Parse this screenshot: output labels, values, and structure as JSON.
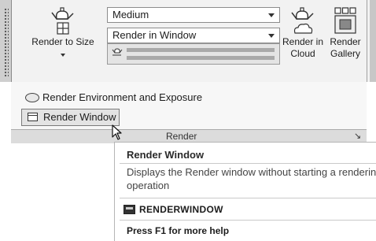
{
  "ribbon": {
    "render_to_size_label": "Render to Size",
    "quality_dropdown": "Medium",
    "output_dropdown": "Render in Window",
    "render_in_cloud_label_1": "Render in",
    "render_in_cloud_label_2": "Cloud",
    "render_gallery_label_1": "Render",
    "render_gallery_label_2": "Gallery",
    "render_env_label": "Render Environment and Exposure",
    "render_window_label": "Render Window",
    "panel_title": "Render",
    "panel_launcher_glyph": "↘"
  },
  "tooltip": {
    "title": "Render Window",
    "description": "Displays the Render window without starting a rendering operation",
    "command": "RENDERWINDOW",
    "help": "Press F1 for more help"
  },
  "icons": {
    "render_to_size": "teapot-grid-icon",
    "render_in_cloud": "teapot-cloud-icon",
    "render_gallery": "gallery-grid-icon",
    "render_env": "environment-icon",
    "render_window": "render-window-icon",
    "command": "command-icon"
  }
}
